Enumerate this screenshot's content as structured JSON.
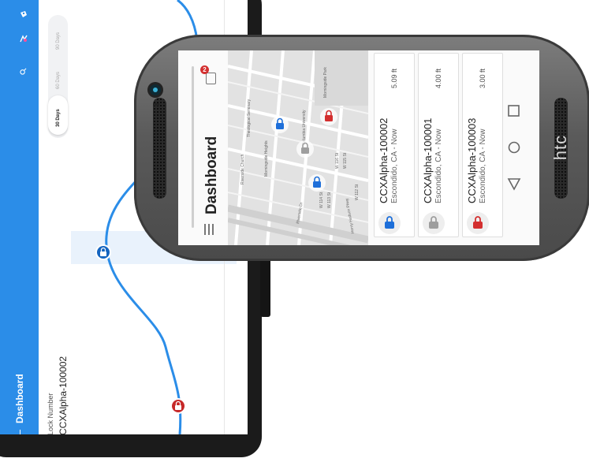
{
  "tablet": {
    "title": "Dashboard",
    "lock_label": "Lock Number",
    "lock_value": "CCXAlpha-100002",
    "ranges": [
      "30 Days",
      "60 Days",
      "90 Days"
    ],
    "active_range": "30 Days",
    "colors": {
      "primary": "#2b8de8",
      "lock_blue": "#1565c0",
      "lock_red": "#c62828"
    }
  },
  "phone": {
    "brand": "htc",
    "title": "Dashboard",
    "notification_count": "2",
    "locks": [
      {
        "id": "CCXAlpha-100002",
        "location": "Escondido, CA - Now",
        "distance": "5.09 ft",
        "status_color": "#1e6fd9"
      },
      {
        "id": "CCXAlpha-100001",
        "location": "Escondido, CA - Now",
        "distance": "4.00 ft",
        "status_color": "#9e9e9e"
      },
      {
        "id": "CCXAlpha-100003",
        "location": "Escondido, CA - Now",
        "distance": "3.00 ft",
        "status_color": "#d32f2f"
      }
    ],
    "map_labels": [
      "Theological Seminary",
      "Riverside Church",
      "Morningside Heights",
      "Columbia University",
      "Riverside Dr",
      "Henry Hudson Pkwy",
      "W 116 St",
      "W 115 St",
      "W 114 St",
      "W 113 St",
      "W 112 St",
      "Morningside Park"
    ],
    "nav": [
      "back-icon",
      "home-icon",
      "recent-apps-icon"
    ]
  }
}
